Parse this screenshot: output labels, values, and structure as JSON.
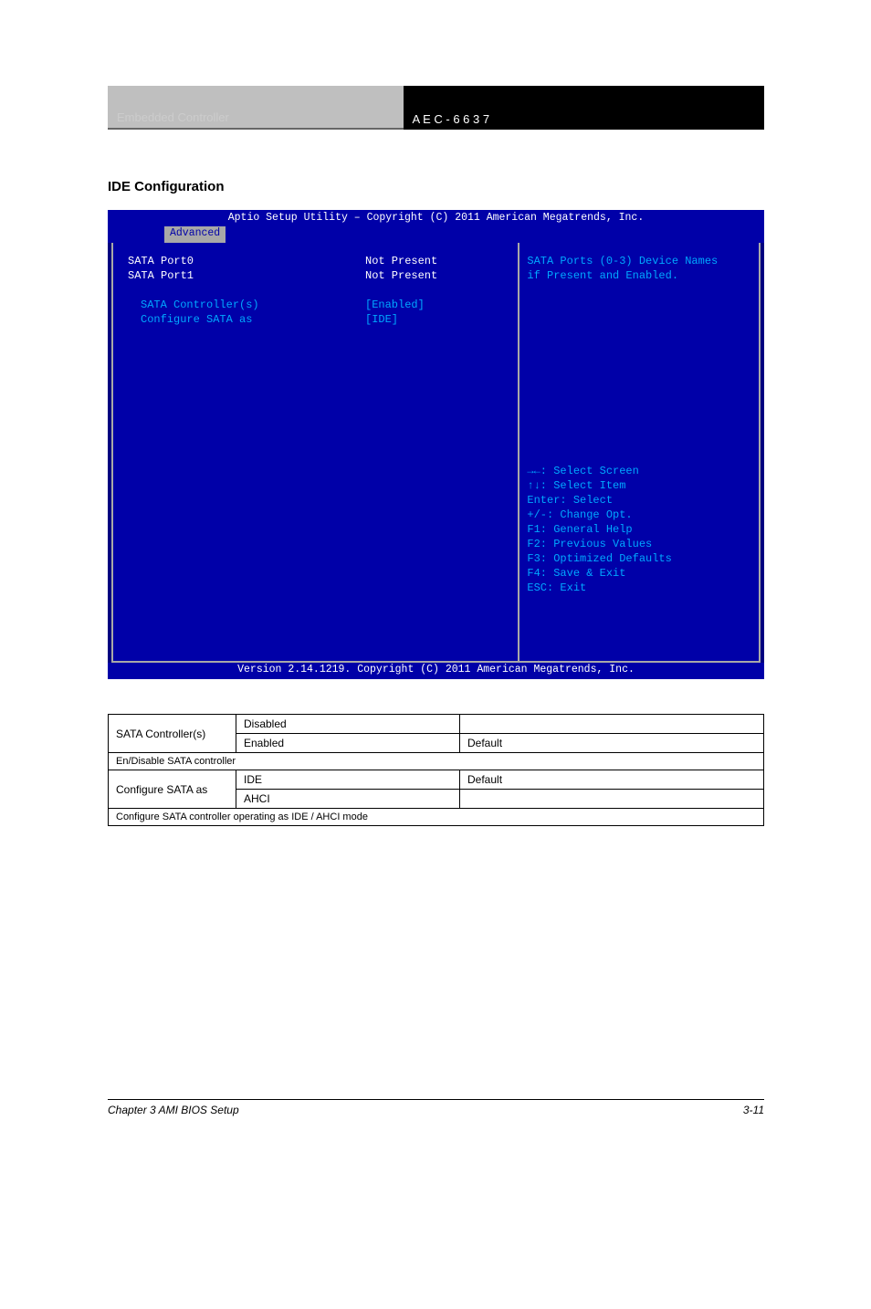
{
  "header": {
    "left": "Embedded Controller",
    "right": "A E C - 6 6 3 7"
  },
  "section": {
    "ide": "IDE Configuration"
  },
  "bios": {
    "title": "Aptio Setup Utility – Copyright (C) 2011 American Megatrends, Inc.",
    "tab": "Advanced",
    "rows": {
      "port0": {
        "lbl": "SATA Port0",
        "val": "Not Present"
      },
      "port1": {
        "lbl": "SATA Port1",
        "val": "Not Present"
      },
      "ctrl": {
        "lbl": "SATA Controller(s)",
        "val": "[Enabled]"
      },
      "cfg": {
        "lbl": "Configure SATA as",
        "val": "[IDE]"
      }
    },
    "help": {
      "l1": "SATA Ports (0-3) Device Names",
      "l2": "if Present and Enabled."
    },
    "keys": [
      "→←: Select Screen",
      "↑↓: Select Item",
      "Enter: Select",
      "+/-: Change Opt.",
      "F1: General Help",
      "F2: Previous Values",
      "F3: Optimized Defaults",
      "F4: Save & Exit",
      "ESC: Exit"
    ],
    "footer": "Version 2.14.1219. Copyright (C) 2011 American Megatrends, Inc."
  },
  "chart_data": {
    "type": "table",
    "tables": [
      {
        "name": "SATA Controller(s)",
        "rows": [
          [
            "SATA Controller(s)",
            "Disabled",
            ""
          ],
          [
            "",
            "Enabled",
            "Default"
          ]
        ],
        "description": "En/Disable SATA controller"
      },
      {
        "name": "Configure SATA as",
        "rows": [
          [
            "Configure SATA as",
            "IDE",
            "Default"
          ],
          [
            "",
            "AHCI",
            ""
          ]
        ],
        "description": "Configure SATA controller operating as IDE / AHCI mode"
      }
    ]
  },
  "footer": {
    "chapter": "Chapter 3 AMI BIOS Setup",
    "page": "3-11"
  }
}
